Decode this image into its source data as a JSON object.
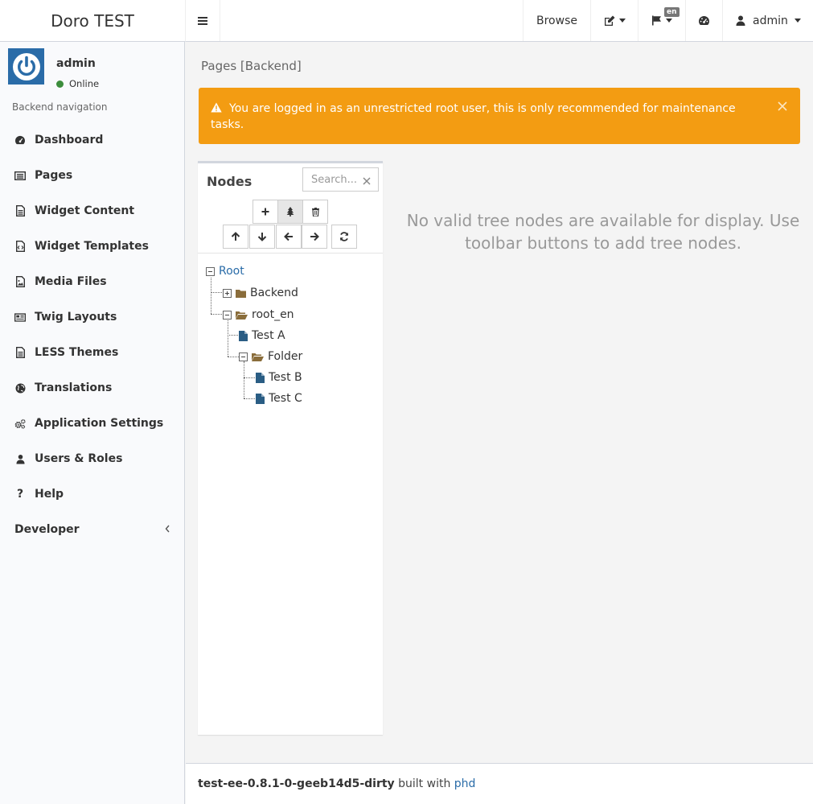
{
  "app": {
    "title": "Doro TEST"
  },
  "topnav": {
    "browse_label": "Browse",
    "language_badge": "en",
    "user_label": "admin"
  },
  "user_panel": {
    "name": "admin",
    "status": "Online",
    "status_color": "#3c8d3c"
  },
  "sidebar": {
    "header": "Backend navigation",
    "items": [
      {
        "label": "Dashboard",
        "icon": "dashboard-icon"
      },
      {
        "label": "Pages",
        "icon": "pages-icon"
      },
      {
        "label": "Widget Content",
        "icon": "file-text-icon"
      },
      {
        "label": "Widget Templates",
        "icon": "file-code-icon"
      },
      {
        "label": "Media Files",
        "icon": "file-image-icon"
      },
      {
        "label": "Twig Layouts",
        "icon": "newspaper-icon"
      },
      {
        "label": "LESS Themes",
        "icon": "file-text-icon"
      },
      {
        "label": "Translations",
        "icon": "globe-icon"
      },
      {
        "label": "Application Settings",
        "icon": "cogs-icon"
      },
      {
        "label": "Users & Roles",
        "icon": "user-icon"
      },
      {
        "label": "Help",
        "icon": "question-icon"
      },
      {
        "label": "Developer",
        "icon": "none"
      }
    ]
  },
  "breadcrumb": "Pages [Backend]",
  "alert": {
    "text": "You are logged in as an unrestricted root user, this is only recommended for maintenance tasks.",
    "color": "#f39c12"
  },
  "nodes_panel": {
    "title": "Nodes",
    "search_placeholder": "Search...",
    "tree": {
      "root": "Root",
      "backend": "Backend",
      "root_en": "root_en",
      "test_a": "Test A",
      "folder": "Folder",
      "test_b": "Test B",
      "test_c": "Test C"
    }
  },
  "empty_message": "No valid tree nodes are available for display. Use toolbar buttons to add tree nodes.",
  "footer": {
    "version": "test-ee-0.8.1-0-geeb14d5-dirty",
    "built_with": "built with",
    "link": "phd"
  },
  "colors": {
    "accent": "#2a6ca8",
    "warning": "#f39c12"
  }
}
